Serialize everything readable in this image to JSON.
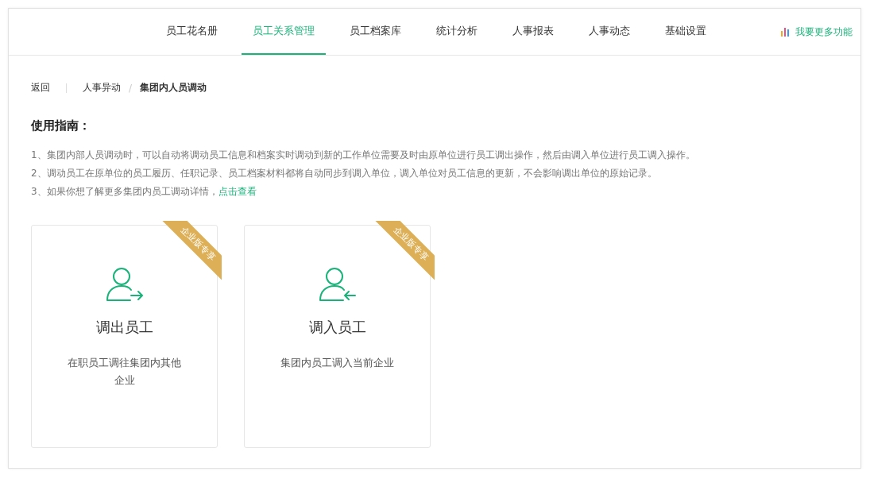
{
  "nav": {
    "tabs": [
      {
        "label": "员工花名册",
        "selected": false
      },
      {
        "label": "员工关系管理",
        "selected": true
      },
      {
        "label": "员工档案库",
        "selected": false
      },
      {
        "label": "统计分析",
        "selected": false
      },
      {
        "label": "人事报表",
        "selected": false
      },
      {
        "label": "人事动态",
        "selected": false
      },
      {
        "label": "基础设置",
        "selected": false
      }
    ],
    "more_link": "我要更多功能"
  },
  "breadcrumb": {
    "back": "返回",
    "separator": "/",
    "items": [
      {
        "label": "人事异动",
        "current": false
      },
      {
        "label": "集团内人员调动",
        "current": true
      }
    ]
  },
  "guide": {
    "title": "使用指南：",
    "lines": [
      {
        "text": "1、集团内部人员调动时，可以自动将调动员工信息和档案实时调动到新的工作单位需要及时由原单位进行员工调出操作，然后由调入单位进行员工调入操作。"
      },
      {
        "text": "2、调动员工在原单位的员工履历、任职记录、员工档案材料都将自动同步到调入单位，调入单位对员工信息的更新，不会影响调出单位的原始记录。"
      },
      {
        "text": "3、如果你想了解更多集团内员工调动详情，",
        "link": "点击查看"
      }
    ]
  },
  "cards": [
    {
      "kind": "out",
      "ribbon": "企业版专享",
      "title": "调出员工",
      "description": "在职员工调往集团内其他企业"
    },
    {
      "kind": "in",
      "ribbon": "企业版专享",
      "title": "调入员工",
      "description": "集团内员工调入当前企业"
    }
  ]
}
